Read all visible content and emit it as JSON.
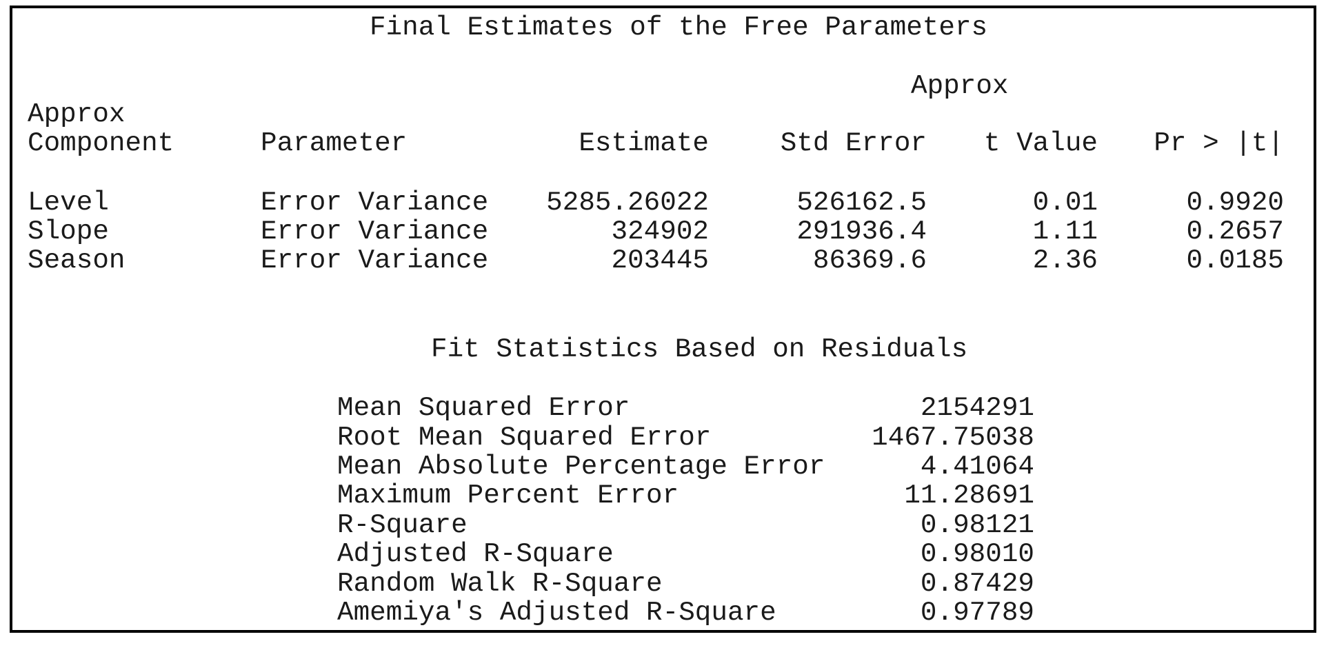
{
  "estimates": {
    "title": "Final Estimates of the Free Parameters",
    "header_approx_top": "Approx",
    "header_approx_left": "Approx",
    "columns": [
      "Component",
      "Parameter",
      "Estimate",
      "Std Error",
      "t Value",
      "Pr > |t|"
    ],
    "rows": [
      {
        "component": "Level",
        "parameter": "Error Variance",
        "estimate": "5285.26022",
        "std_error": "526162.5",
        "t_value": "0.01",
        "p_value": "0.9920"
      },
      {
        "component": "Slope",
        "parameter": "Error Variance",
        "estimate": "324902",
        "std_error": "291936.4",
        "t_value": "1.11",
        "p_value": "0.2657"
      },
      {
        "component": "Season",
        "parameter": "Error Variance",
        "estimate": "203445",
        "std_error": "86369.6",
        "t_value": "2.36",
        "p_value": "0.0185"
      }
    ]
  },
  "fit_statistics": {
    "title": "Fit Statistics Based on Residuals",
    "rows": [
      {
        "label": "Mean Squared Error",
        "value": "2154291"
      },
      {
        "label": "Root Mean Squared Error",
        "value": "1467.75038"
      },
      {
        "label": "Mean Absolute Percentage Error",
        "value": "4.41064"
      },
      {
        "label": "Maximum Percent Error",
        "value": "11.28691"
      },
      {
        "label": "R-Square",
        "value": "0.98121"
      },
      {
        "label": "Adjusted R-Square",
        "value": "0.98010"
      },
      {
        "label": "Random Walk R-Square",
        "value": "0.87429"
      },
      {
        "label": "Amemiya's Adjusted R-Square",
        "value": "0.97789"
      }
    ]
  }
}
